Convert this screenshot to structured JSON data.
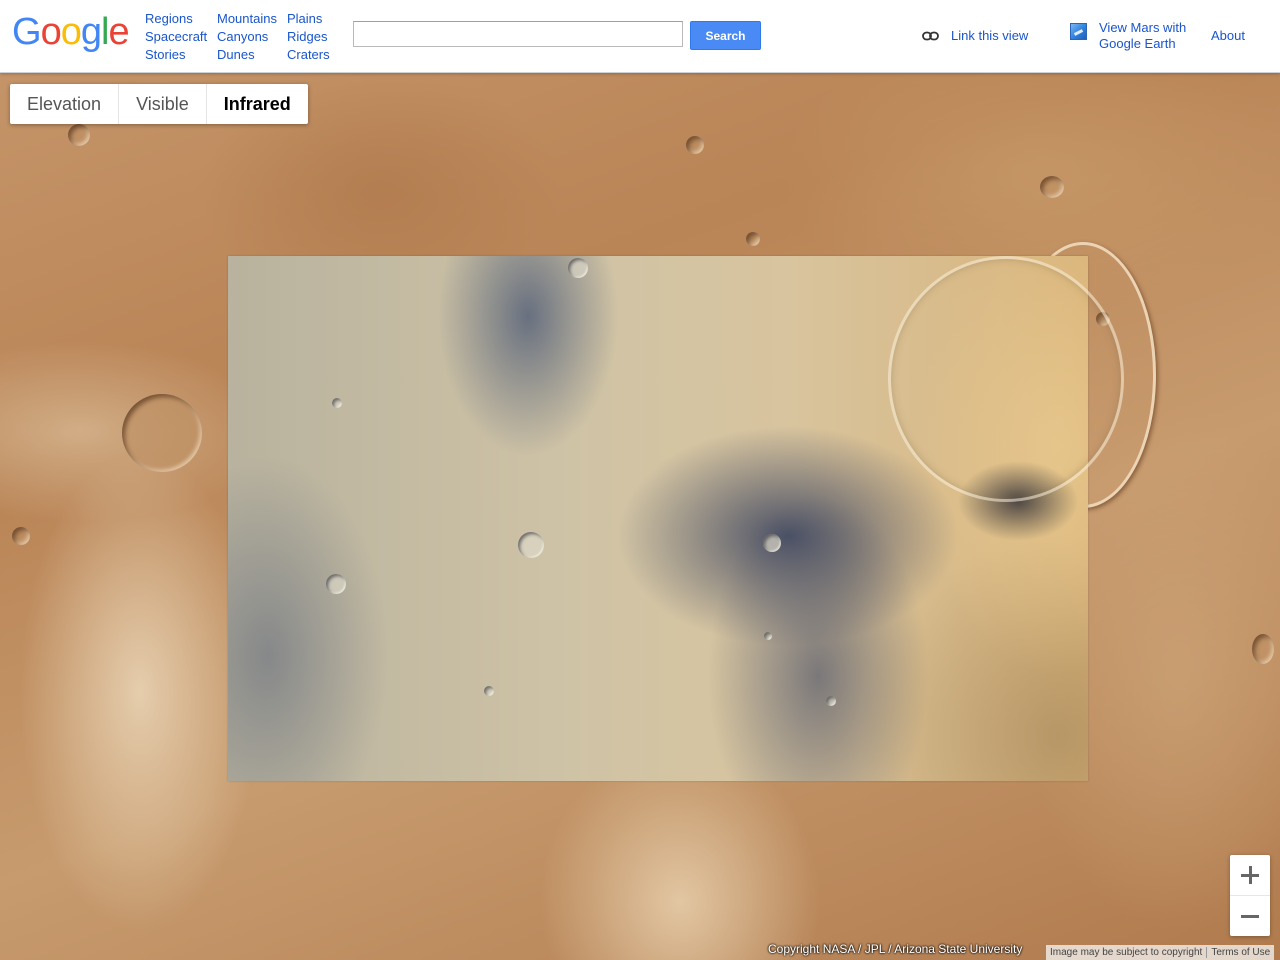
{
  "header": {
    "logo": {
      "letters": [
        "G",
        "o",
        "o",
        "g",
        "l",
        "e"
      ],
      "colors": [
        "#4285F4",
        "#EA4335",
        "#FBBC05",
        "#4285F4",
        "#34A853",
        "#EA4335"
      ]
    },
    "nav_columns": [
      [
        "Regions",
        "Spacecraft",
        "Stories"
      ],
      [
        "Mountains",
        "Canyons",
        "Dunes"
      ],
      [
        "Plains",
        "Ridges",
        "Craters"
      ]
    ],
    "search": {
      "value": "",
      "placeholder": "",
      "button_label": "Search"
    },
    "link_view_label": "Link this view",
    "link_view_icon": "link-icon",
    "earth_link": {
      "line1": "View Mars with",
      "line2": "Google Earth",
      "icon": "google-earth-icon"
    },
    "about_label": "About"
  },
  "layer_tabs": {
    "items": [
      "Elevation",
      "Visible",
      "Infrared"
    ],
    "active": "Infrared"
  },
  "zoom": {
    "in_icon": "plus-icon",
    "out_icon": "minus-icon"
  },
  "footer": {
    "copyright": "Copyright NASA / JPL / Arizona State University",
    "image_notice": "Image may be subject to copyright",
    "terms": "Terms of Use"
  },
  "colors": {
    "link": "#1a55cc",
    "search_button": "#4a8af4"
  }
}
